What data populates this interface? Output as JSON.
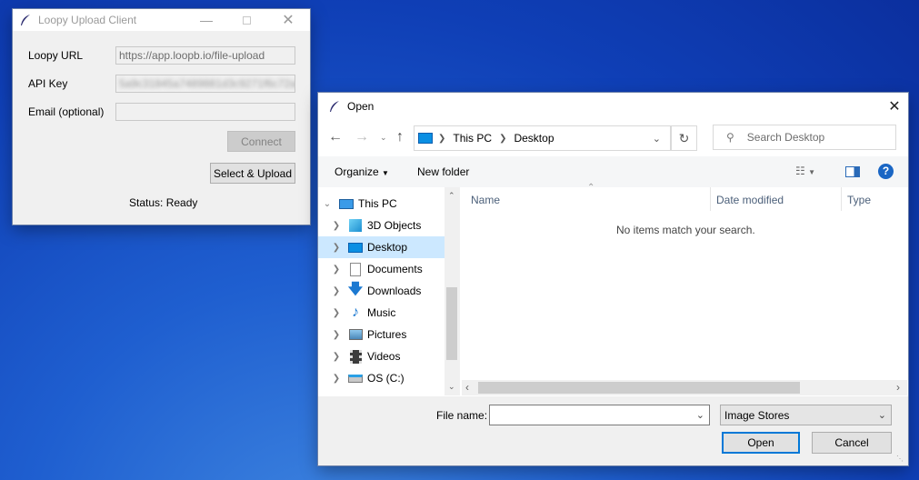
{
  "client": {
    "title": "Loopy Upload Client",
    "url_label": "Loopy URL",
    "url_value": "https://app.loopb.io/file-upload",
    "apikey_label": "API Key",
    "apikey_value": "5a9c31845a7489881d3c9271f6c72ac",
    "email_label": "Email (optional)",
    "email_value": "",
    "connect_label": "Connect",
    "upload_label": "Select & Upload",
    "status": "Status: Ready"
  },
  "dialog": {
    "title": "Open",
    "breadcrumb": [
      "This PC",
      "Desktop"
    ],
    "search_placeholder": "Search Desktop",
    "organize_label": "Organize",
    "new_folder_label": "New folder",
    "nav_items": [
      {
        "label": "This PC",
        "icon": "pc-icon",
        "expanded": true
      },
      {
        "label": "3D Objects",
        "icon": "cube-icon"
      },
      {
        "label": "Desktop",
        "icon": "desktop-icon",
        "selected": true
      },
      {
        "label": "Documents",
        "icon": "document-icon"
      },
      {
        "label": "Downloads",
        "icon": "download-icon"
      },
      {
        "label": "Music",
        "icon": "music-icon"
      },
      {
        "label": "Pictures",
        "icon": "picture-icon"
      },
      {
        "label": "Videos",
        "icon": "video-icon"
      },
      {
        "label": "OS (C:)",
        "icon": "drive-icon"
      }
    ],
    "columns": [
      "Name",
      "Date modified",
      "Type"
    ],
    "empty_message": "No items match your search.",
    "filename_label": "File name:",
    "filename_value": "",
    "filetype_value": "Image Stores",
    "open_label": "Open",
    "cancel_label": "Cancel"
  },
  "colors": {
    "selection": "#cce8ff",
    "accent": "#0078d7",
    "desktop": "#1f5fd0"
  }
}
